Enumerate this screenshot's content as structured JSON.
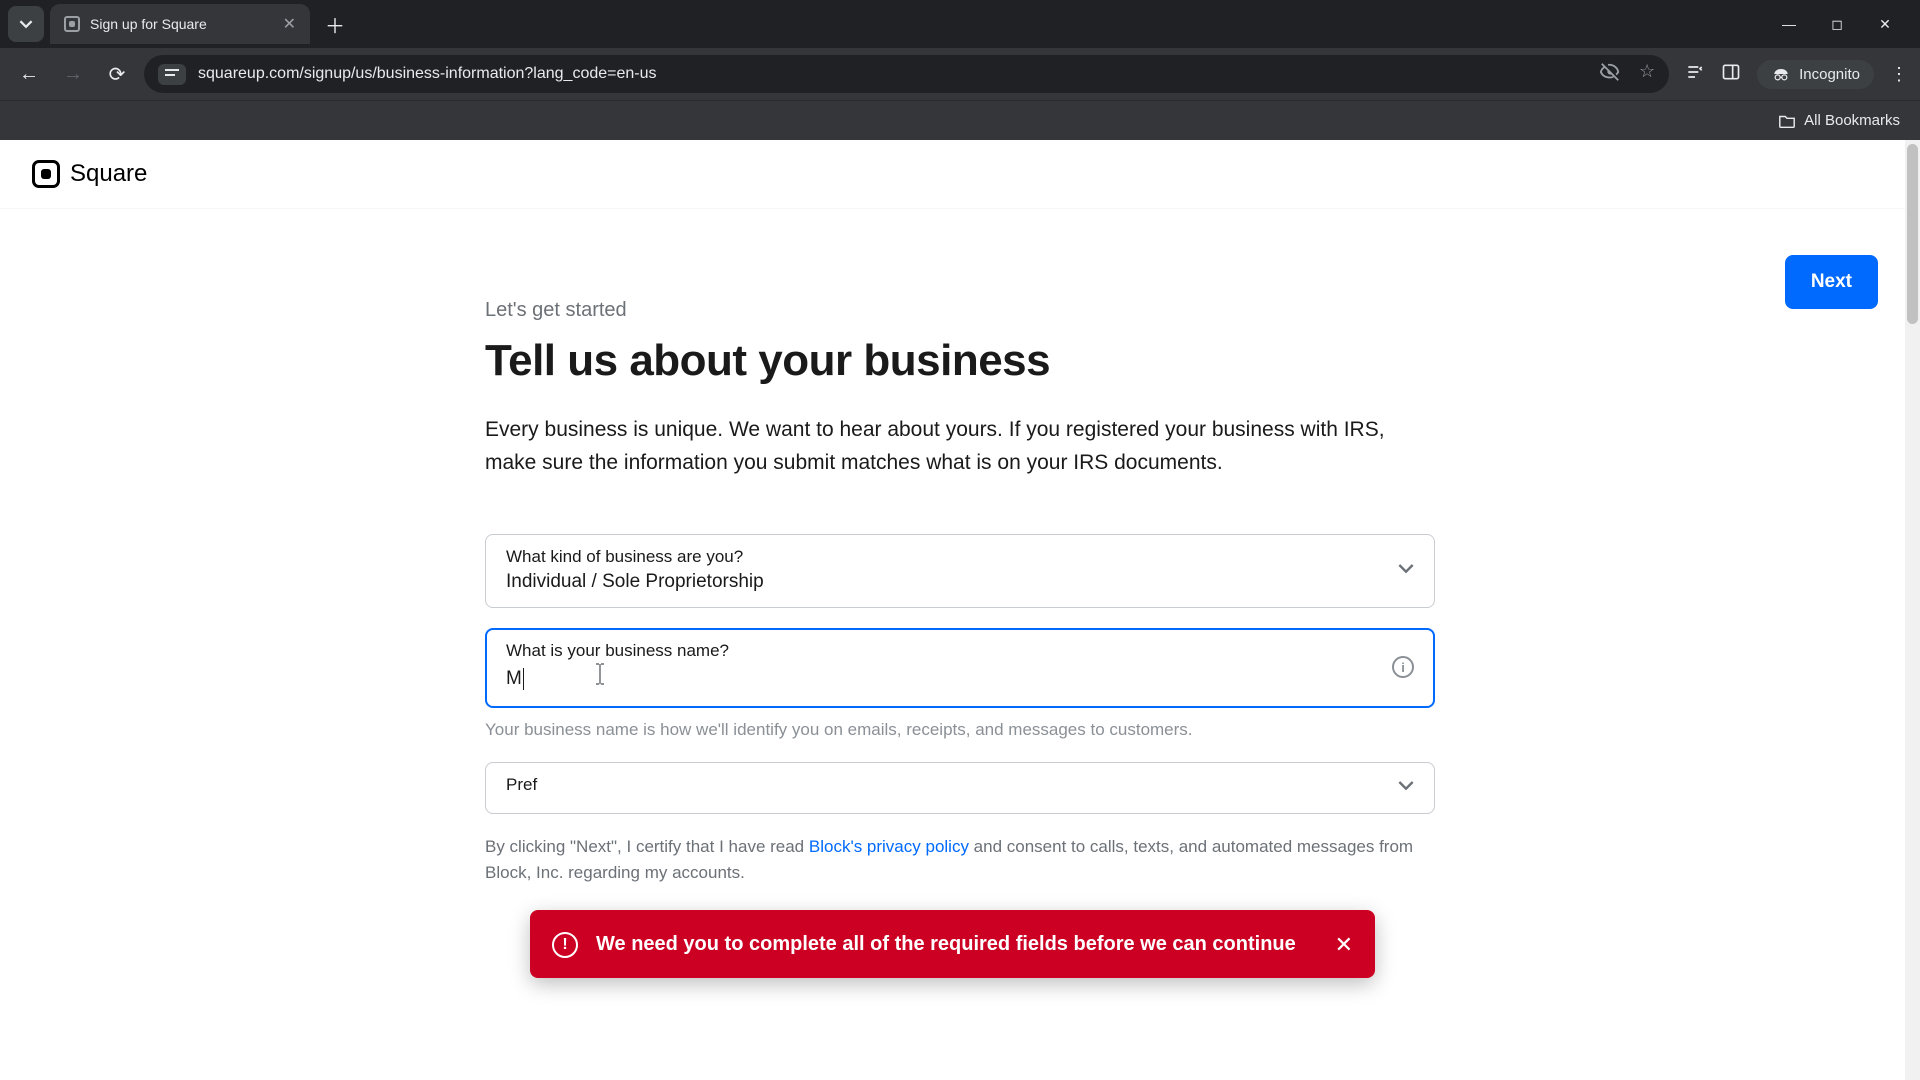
{
  "browser": {
    "tab_title": "Sign up for Square",
    "url": "squareup.com/signup/us/business-information?lang_code=en-us",
    "incognito_label": "Incognito",
    "all_bookmarks": "All Bookmarks"
  },
  "header": {
    "brand": "Square"
  },
  "actions": {
    "next": "Next"
  },
  "form": {
    "kicker": "Let's get started",
    "headline": "Tell us about your business",
    "intro": "Every business is unique. We want to hear about yours. If you registered your business with IRS, make sure the information you submit matches what is on your IRS documents.",
    "business_type": {
      "label": "What kind of business are you?",
      "value": "Individual / Sole Proprietorship"
    },
    "business_name": {
      "label": "What is your business name?",
      "value": "M",
      "helper": "Your business name is how we'll identify you on emails, receipts, and messages to customers."
    },
    "preferred_language": {
      "label": "Pref"
    },
    "consent_prefix": "By clicking \"Next\", I certify that I have read ",
    "consent_link": "Block's privacy policy",
    "consent_suffix": " and consent to calls, texts, and automated messages from Block, Inc. regarding my accounts."
  },
  "toast": {
    "message": "We need you to complete all of the required fields before we can continue"
  }
}
